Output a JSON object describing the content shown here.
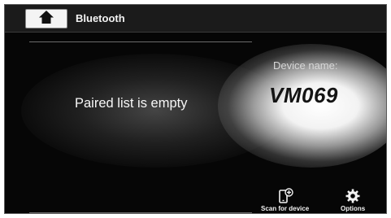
{
  "header": {
    "home_icon": "home-icon",
    "title": "Bluetooth"
  },
  "main": {
    "paired_message": "Paired list is empty",
    "device_label": "Device name:",
    "device_name": "VM069"
  },
  "actions": {
    "scan": {
      "label": "Scan for device",
      "icon": "phone-add-icon"
    },
    "options": {
      "label": "Options",
      "icon": "gear-icon"
    }
  }
}
